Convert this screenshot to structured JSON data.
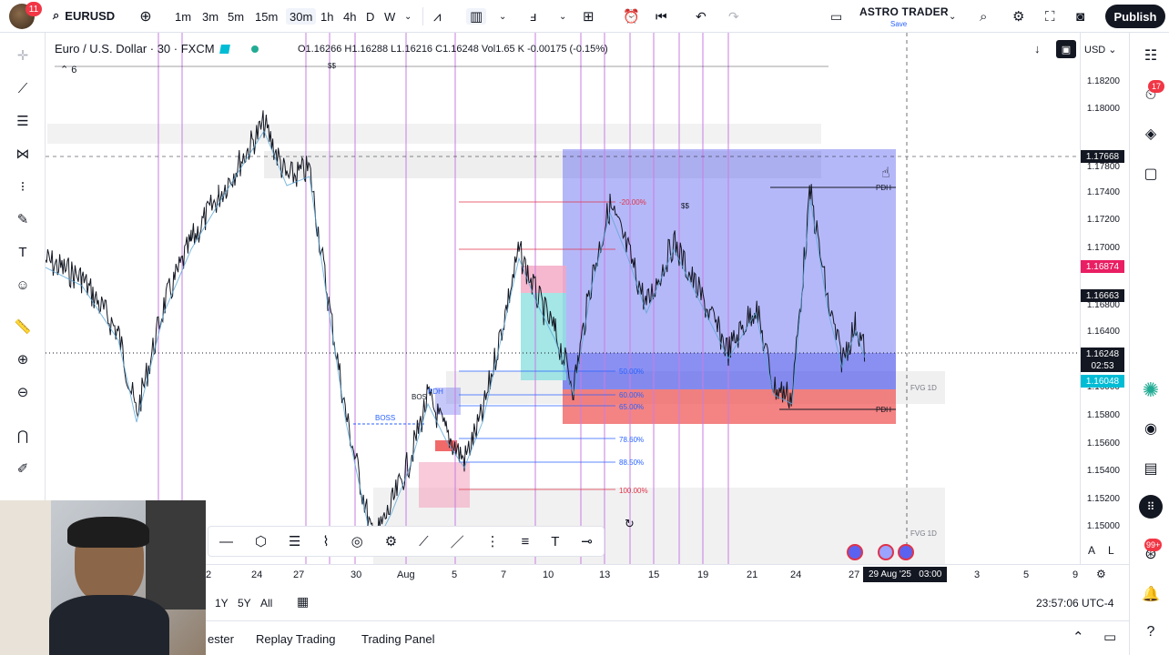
{
  "topbar": {
    "notif_count": "11",
    "symbol": "EURUSD",
    "intervals": [
      "1m",
      "3m",
      "5m",
      "15m",
      "30m",
      "1h",
      "4h",
      "D",
      "W"
    ],
    "active_interval": "30m",
    "layout_name": "ASTRO TRADER",
    "layout_save": "Save",
    "publish_label": "Publish"
  },
  "legend": {
    "title": "Euro / U.S. Dollar · 30 · FXCM",
    "open": "O1.16266",
    "high": "H1.16288",
    "low": "L1.16216",
    "close": "C1.16248",
    "volume": "Vol1.65 K",
    "change": "-0.00175 (-0.15%)",
    "indicator_count": "6"
  },
  "price_scale": {
    "currency": "USD",
    "labels": [
      "1.18200",
      "1.18000",
      "1.17800",
      "1.17400",
      "1.17200",
      "1.17000",
      "1.16800",
      "1.16400",
      "1.16000",
      "1.15800",
      "1.15600",
      "1.15400",
      "1.15200",
      "1.15000"
    ],
    "crosshair_price": "1.17668",
    "tag_pink": "1.16874",
    "tag_dark": "1.16663",
    "last_price": "1.16248",
    "countdown": "02:53",
    "tag_cyan": "1.16048",
    "auto_label": "A",
    "log_label": "L"
  },
  "time_scale": {
    "labels": [
      "2",
      "24",
      "27",
      "30",
      "Aug",
      "5",
      "7",
      "10",
      "13",
      "15",
      "19",
      "21",
      "24",
      "27",
      "3",
      "5",
      "9"
    ],
    "crosshair_time": "29 Aug '25   03:00"
  },
  "chart_labels": {
    "fib": [
      "-20.00%",
      "50.00%",
      "60.00%",
      "65.00%",
      "78.60%",
      "88.50%",
      "100.00%"
    ],
    "pdh": "PDH",
    "boss": "BOSS",
    "bos": "BOS",
    "fvg": "FVG  1D",
    "ss": "$$"
  },
  "bottom": {
    "ranges": [
      "1Y",
      "5Y",
      "All"
    ],
    "clock": "23:57:06 UTC-4"
  },
  "panels": {
    "tester": "ester",
    "replay": "Replay Trading",
    "trading_panel": "Trading Panel"
  },
  "right_badges": {
    "alerts": "17",
    "chat": "99+"
  },
  "colors": {
    "accent": "#2962ff",
    "bear": "#f23645",
    "zone_blue": "#5b62f0",
    "zone_red": "#f05a5a",
    "vline": "#c77de2"
  }
}
